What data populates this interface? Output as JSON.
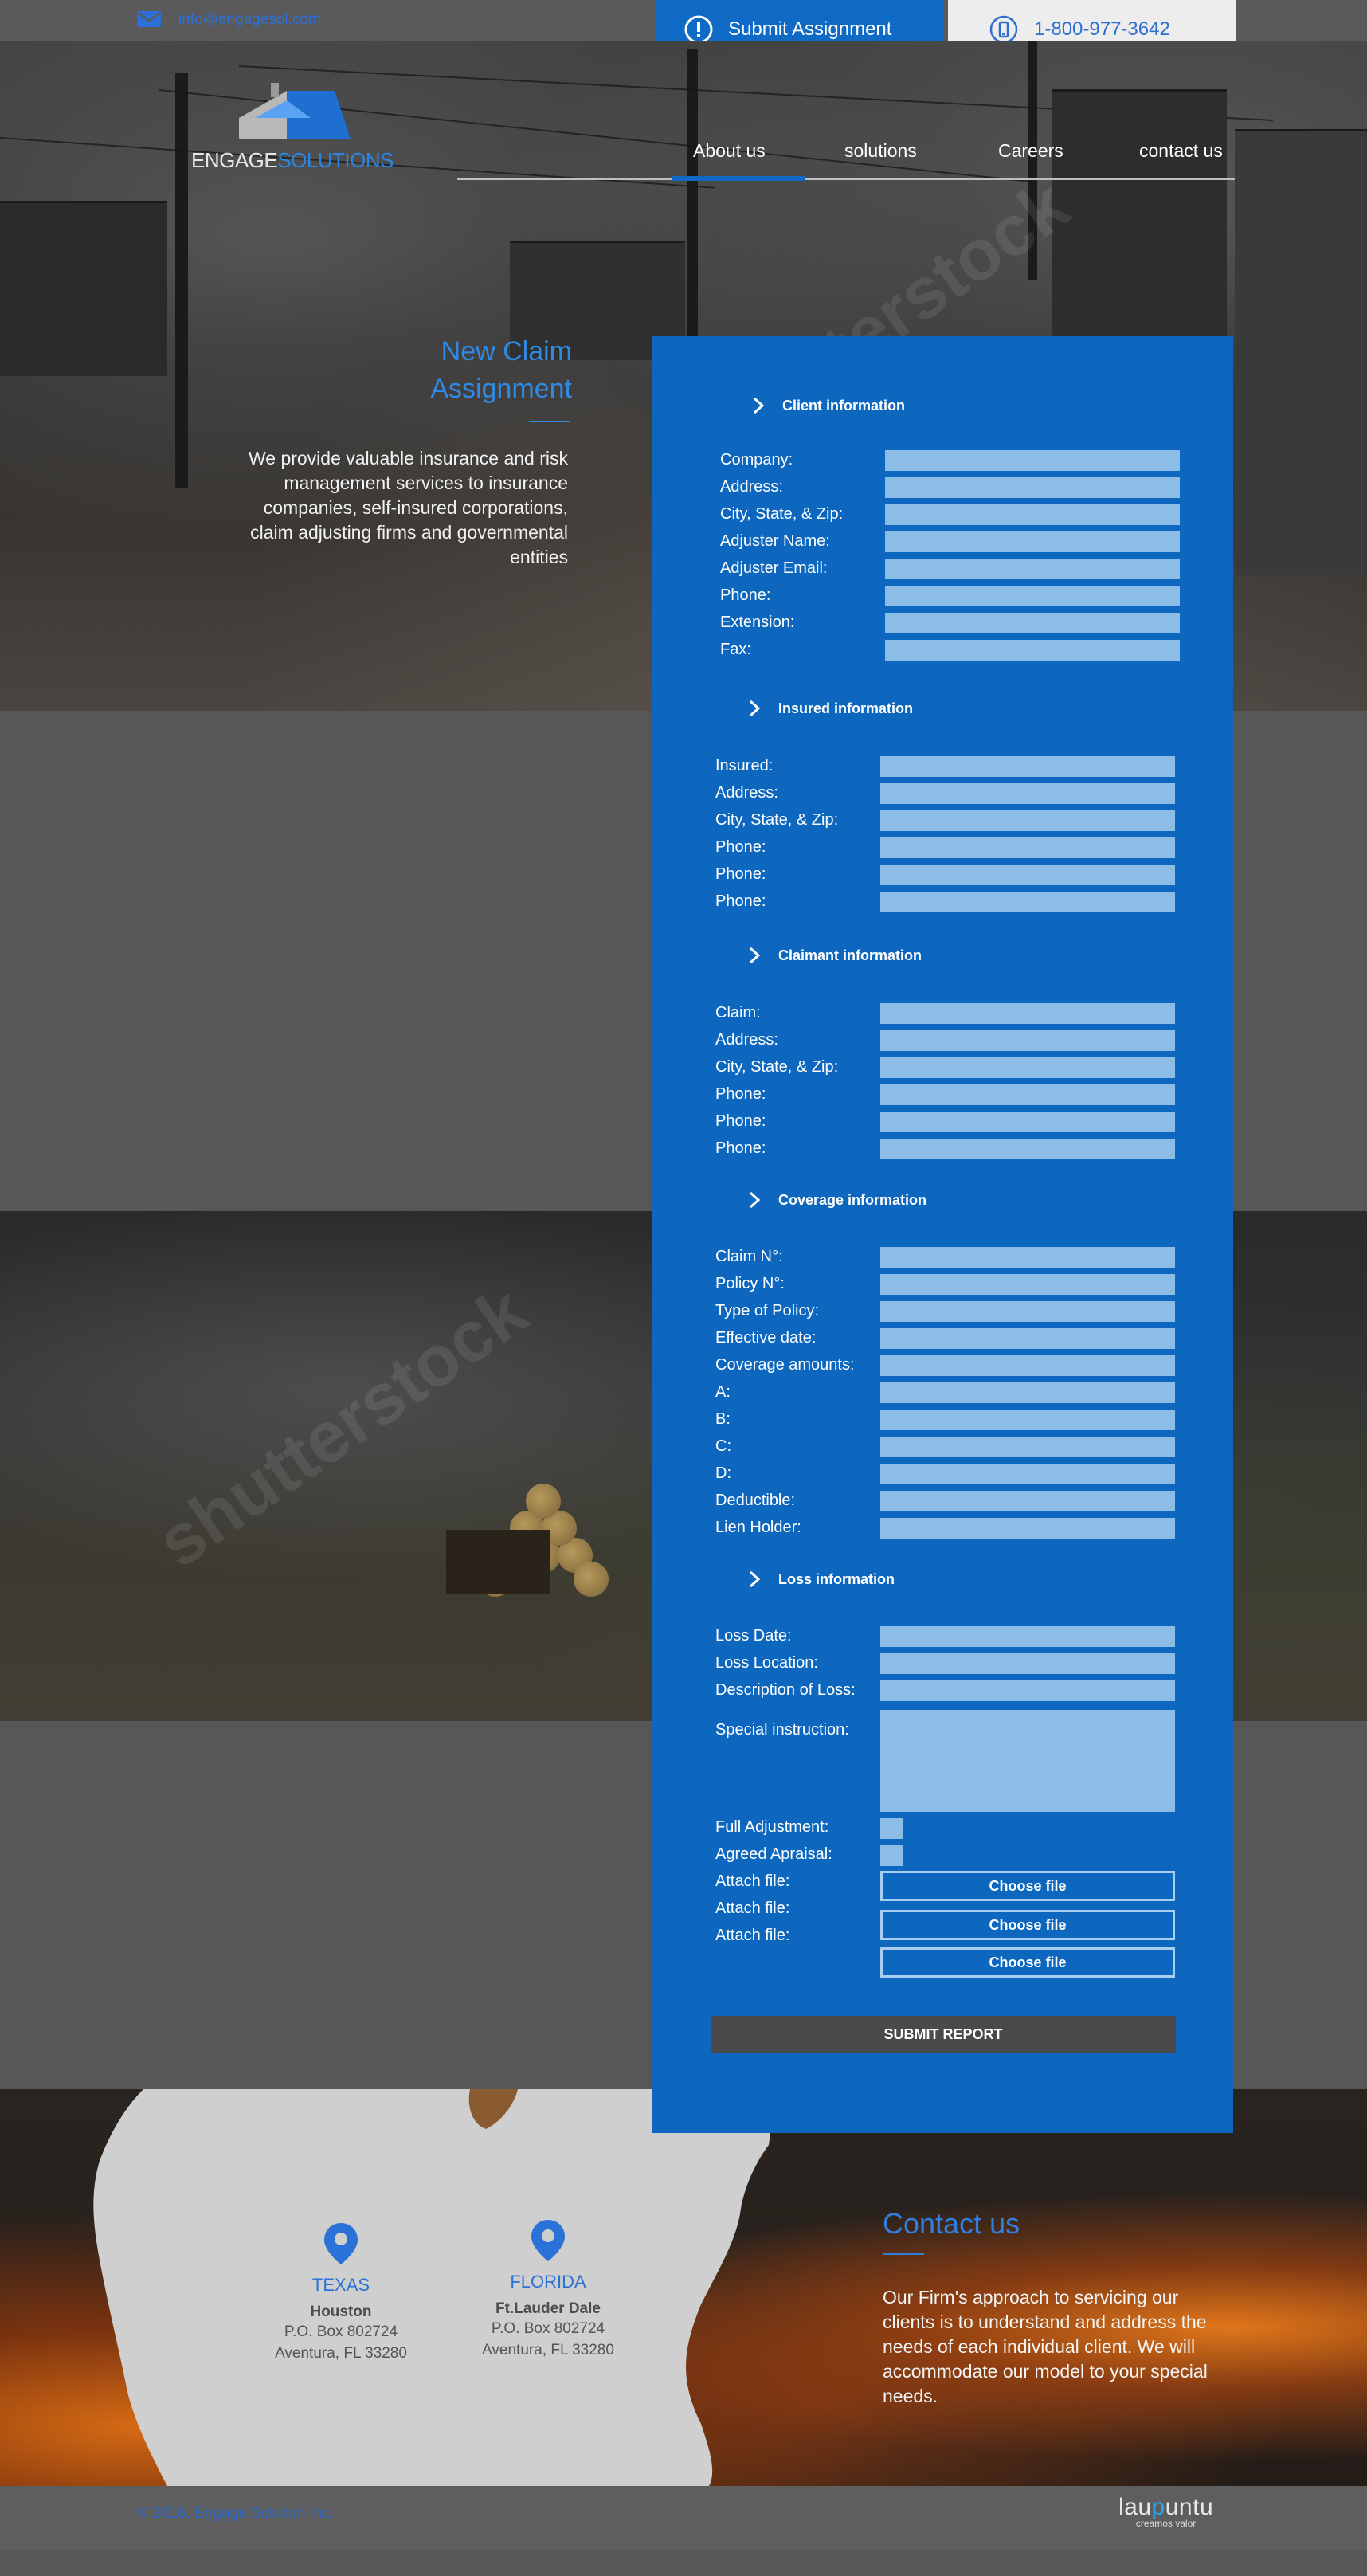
{
  "topbar": {
    "email": "info@engagesol.com",
    "submit_label": "Submit Assignment",
    "phone": "1-800-977-3642"
  },
  "logo": {
    "part1": "ENGAGE",
    "part2": "SOLUTIONS"
  },
  "nav": [
    {
      "label": "About us",
      "active": true
    },
    {
      "label": "solutions"
    },
    {
      "label": "Careers"
    },
    {
      "label": "contact us"
    }
  ],
  "hero": {
    "title_line1": "New Claim",
    "title_line2": "Assignment",
    "description": "We provide valuable insurance and risk management services to insurance companies, self-insured corporations, claim adjusting firms and governmental entities"
  },
  "form": {
    "client": {
      "title": "Client information",
      "fields": [
        "Company:",
        "Address:",
        "City, State, & Zip:",
        "Adjuster Name:",
        "Adjuster Email:",
        "Phone:",
        "Extension:",
        "Fax:"
      ]
    },
    "insured": {
      "title": "Insured information",
      "fields": [
        "Insured:",
        "Address:",
        "City, State, & Zip:",
        "Phone:",
        "Phone:",
        "Phone:"
      ]
    },
    "claimant": {
      "title": "Claimant information",
      "fields": [
        "Claim:",
        "Address:",
        "City, State, & Zip:",
        "Phone:",
        "Phone:",
        "Phone:"
      ]
    },
    "coverage": {
      "title": "Coverage information",
      "fields": [
        "Claim N°:",
        "Policy N°:",
        "Type of Policy:",
        "Effective date:",
        "Coverage amounts:",
        "A:",
        "B:",
        "C:",
        "D:",
        "Deductible:",
        "Lien Holder:"
      ]
    },
    "loss": {
      "title": "Loss information",
      "fields": [
        "Loss Date:",
        "Loss Location:",
        "Description of Loss:"
      ],
      "special": "Special instruction:"
    },
    "checks": [
      "Full Adjustment:",
      "Agreed Apraisal:"
    ],
    "attach_label": "Attach file:",
    "choose_label": "Choose file",
    "submit_label": "SUBMIT REPORT"
  },
  "locations": [
    {
      "state": "TEXAS",
      "city": "Houston",
      "line1": "P.O. Box 802724",
      "line2": "Aventura, FL 33280"
    },
    {
      "state": "FLORIDA",
      "city": "Ft.Lauder Dale",
      "line1": "P.O. Box 802724",
      "line2": "Aventura, FL 33280"
    }
  ],
  "contact": {
    "title": "Contact us",
    "text": "Our Firm's approach to servicing our clients is to understand and address the needs of each individual client. We will accommodate our model to your special needs."
  },
  "footer": {
    "copyright": "© 2016.  Engage Solution Inc.",
    "brand_a": "lau",
    "brand_u": "p",
    "brand_b": "untu",
    "brand_sub": "creamos valor"
  },
  "watermark": "shutterstock",
  "colors": {
    "primary": "#0d67bf",
    "accent": "#2f8ae6",
    "field": "#8cbde6",
    "dark": "#575757"
  }
}
